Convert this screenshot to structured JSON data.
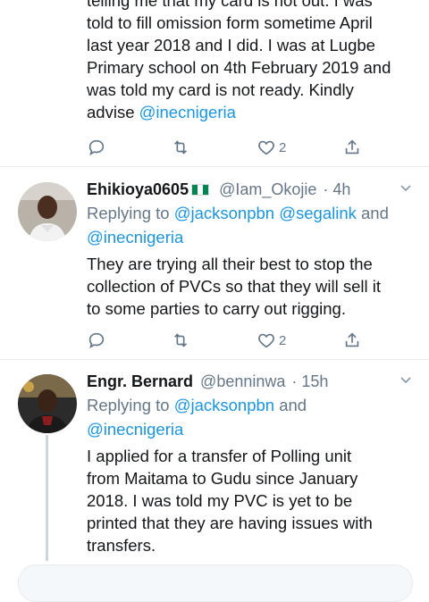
{
  "tweet1": {
    "text_lines": [
      "telling me that my card is not out. I was",
      "told to fill omission form sometime April",
      "last year 2018 and I did. I was at Lugbe",
      "Primary school on 4th February 2019 and",
      "was told my card is not ready. Kindly"
    ],
    "last_line_prefix": "advise ",
    "last_line_mention": "@inecnigeria",
    "like_count": "2"
  },
  "tweet2": {
    "name": "Ehikioya0605",
    "flag_icon": "nigeria-flag-icon",
    "handle": "@Iam_Okojie",
    "time": "· 4h",
    "replying_prefix": "Replying to ",
    "replying_m1": "@jacksonpbn",
    "replying_m2": "@segalink",
    "replying_and": " and",
    "replying_m3": "@inecnigeria",
    "text_lines": [
      "They are trying all their best to stop the",
      "collection of PVCs so that they will sell it",
      "to some parties to carry out rigging."
    ],
    "like_count": "2"
  },
  "tweet3": {
    "name": "Engr. Bernard",
    "handle": "@benninwa",
    "time": "· 15h",
    "replying_prefix": "Replying to ",
    "replying_m1": "@jacksonpbn",
    "replying_and": " and",
    "replying_m2": "@inecnigeria",
    "text_lines": [
      "I applied for a transfer of Polling unit",
      "from Maitama to Gudu since January",
      "2018. I was told my PVC is yet to be",
      "printed that they are having issues with",
      "transfers."
    ]
  },
  "colors": {
    "link": "#1b95e0",
    "muted": "#657786",
    "text": "#14171a"
  }
}
